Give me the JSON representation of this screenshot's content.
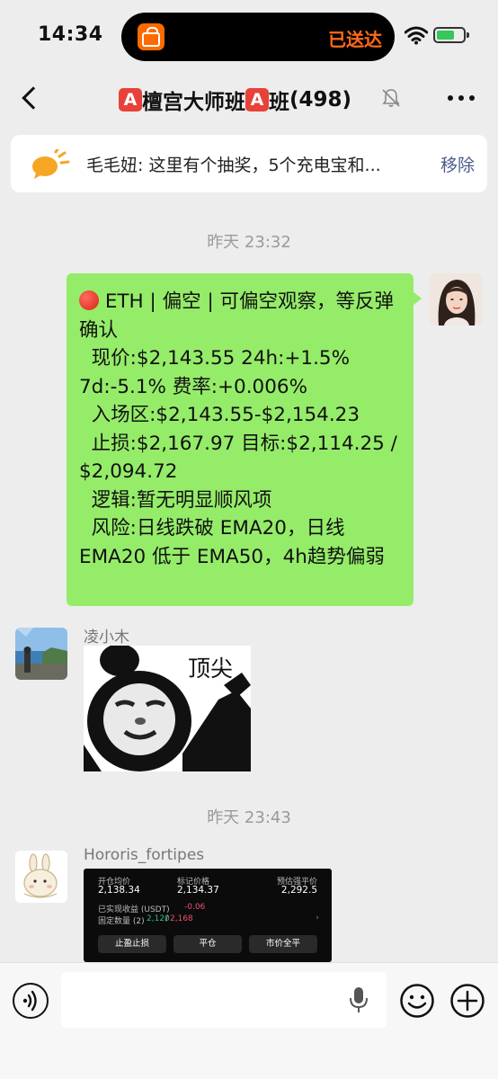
{
  "status_bar": {
    "time": "14:34",
    "island_status": "已送达"
  },
  "nav": {
    "title_badge": "A",
    "title": "檀宫大师班",
    "title_suffix": "班",
    "member_count": "(498)"
  },
  "pinned": {
    "text": "毛毛妞: 这里有个抽奖，5个充电宝和...",
    "action": "移除"
  },
  "messages": {
    "timestamp_1": "昨天 23:32",
    "my_message": {
      "text": " ETH | 偏空 | 可偏空观察，等反弹确认\n  现价:$2,143.55 24h:+1.5% 7d:-5.1% 费率:+0.006%\n  入场区:$2,143.55-$2,154.23\n  止损:$2,167.97 目标:$2,114.25 / $2,094.72\n  逻辑:暂无明显顺风项\n  风险:日线跌破 EMA20，日线 EMA20 低于 EMA50，4h趋势偏弱"
    },
    "sender_1": "凌小木",
    "sticker_caption": "顶尖",
    "timestamp_2": "昨天 23:43",
    "sender_2": "Hororis_fortipes",
    "trade_image": {
      "open_price_label": "开仓均价",
      "open_price": "2,138.34",
      "mark_price_label": "标记价格",
      "mark_price": "2,134.37",
      "liq_price_label": "预估强平价",
      "liq_price": "2,292.5",
      "realized_label": "已实现收益 (USDT)",
      "realized_value": "-0.06",
      "fixed_qty_label": "固定数量 (2)",
      "fixed_qty_a": "2,120",
      "fixed_qty_sep": "/",
      "fixed_qty_b": "2,168",
      "btn_tp_sl": "止盈止损",
      "btn_close": "平仓",
      "btn_market_close": "市价全平"
    }
  },
  "colors": {
    "bubble_green": "#95ec69",
    "background": "#ededed",
    "link_blue": "#4a5e8a",
    "badge_red": "#e8413a"
  }
}
